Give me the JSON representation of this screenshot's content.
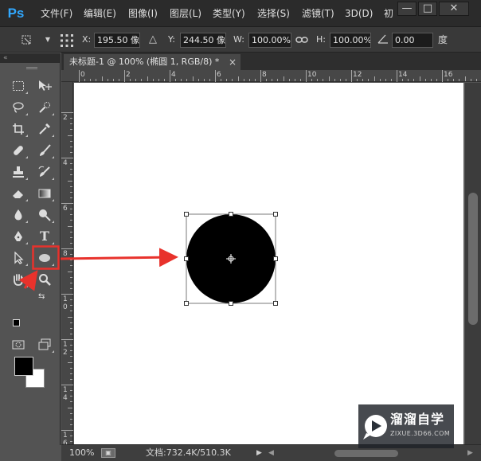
{
  "app": {
    "logo": "Ps"
  },
  "menu": [
    {
      "label": "文件(F)"
    },
    {
      "label": "编辑(E)"
    },
    {
      "label": "图像(I)"
    },
    {
      "label": "图层(L)"
    },
    {
      "label": "类型(Y)"
    },
    {
      "label": "选择(S)"
    },
    {
      "label": "滤镜(T)"
    },
    {
      "label": "3D(D)"
    },
    {
      "label": "初"
    }
  ],
  "window_controls": {
    "minimize": "—",
    "restore": "□",
    "close": "✕"
  },
  "options": {
    "x_label": "X:",
    "x_value": "195.50 像",
    "y_label": "Y:",
    "y_value": "244.50 像",
    "w_label": "W:",
    "w_value": "100.00%",
    "h_label": "H:",
    "h_value": "100.00%",
    "angle_value": "0.00",
    "angle_unit": "度"
  },
  "document": {
    "tab_title": "未标题-1 @ 100% (椭圆 1, RGB/8) *",
    "close": "×"
  },
  "rulers": {
    "h_labels": [
      "0",
      "2",
      "4",
      "6",
      "8",
      "10",
      "12",
      "14",
      "16"
    ],
    "v_labels": [
      "2",
      "4",
      "6",
      "8",
      "1\n0",
      "1\n2",
      "1\n4",
      "1\n6"
    ]
  },
  "status": {
    "zoom": "100%",
    "doc_info": "文档:732.4K/510.3K"
  },
  "watermark": {
    "title": "溜溜自学",
    "subtitle": "ZIXUE.3D66.COM"
  },
  "colors": {
    "annotation": "#e8322c",
    "accent": "#31a8ff",
    "foreground": "#000000",
    "background": "#ffffff"
  },
  "tools": [
    "rect-marquee-icon",
    "move-icon",
    "lasso-icon",
    "quick-select-icon",
    "crop-icon",
    "eyedropper-icon",
    "healing-brush-icon",
    "brush-icon",
    "clone-stamp-icon",
    "history-brush-icon",
    "eraser-icon",
    "gradient-icon",
    "blur-icon",
    "dodge-icon",
    "pen-icon",
    "type-icon",
    "path-select-icon",
    "ellipse-icon",
    "hand-icon",
    "zoom-icon"
  ]
}
